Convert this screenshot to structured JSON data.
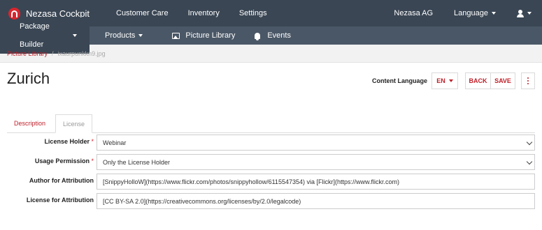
{
  "app": {
    "brand": "Nezasa Cockpit"
  },
  "topnav": {
    "items": [
      "Customer Care",
      "Inventory",
      "Settings"
    ],
    "account": "Nezasa AG",
    "language_menu": "Language"
  },
  "subnav": {
    "package_builder": "Package Builder",
    "products": "Products",
    "picture_library": "Picture Library",
    "events": "Events"
  },
  "breadcrumb": {
    "parent": "Picture Library",
    "separator": "/",
    "current": "ixaurpunkkn9.jpg"
  },
  "header": {
    "title": "Zurich",
    "content_language_label": "Content Language",
    "content_language_value": "EN",
    "back_label": "BACK",
    "save_label": "SAVE"
  },
  "tabs": [
    {
      "label": "Description",
      "active": true
    },
    {
      "label": "License",
      "active": false
    }
  ],
  "form": {
    "license_holder": {
      "label": "License Holder",
      "required": true,
      "value": "Webinar"
    },
    "usage_permission": {
      "label": "Usage Permission",
      "required": true,
      "value": "Only the License Holder"
    },
    "author_attribution": {
      "label": "Author for Attribution",
      "value": "[SnippyHolloW](https://www.flickr.com/photos/snippyhollow/6115547354) via [Flickr](https://www.flickr.com)"
    },
    "license_attribution": {
      "label": "License for Attribution",
      "value": "[CC BY-SA 2.0](https://creativecommons.org/licenses/by/2.0/legalcode)"
    },
    "required_marker": "*"
  },
  "colors": {
    "topbar": "#3a4654",
    "subbar": "#4a5766",
    "accent": "#c0202a"
  },
  "icons": [
    "nezasa-logo-icon",
    "caret-down-icon",
    "user-icon",
    "picture-icon",
    "bell-icon",
    "kebab-menu-icon",
    "chevron-down-icon"
  ]
}
